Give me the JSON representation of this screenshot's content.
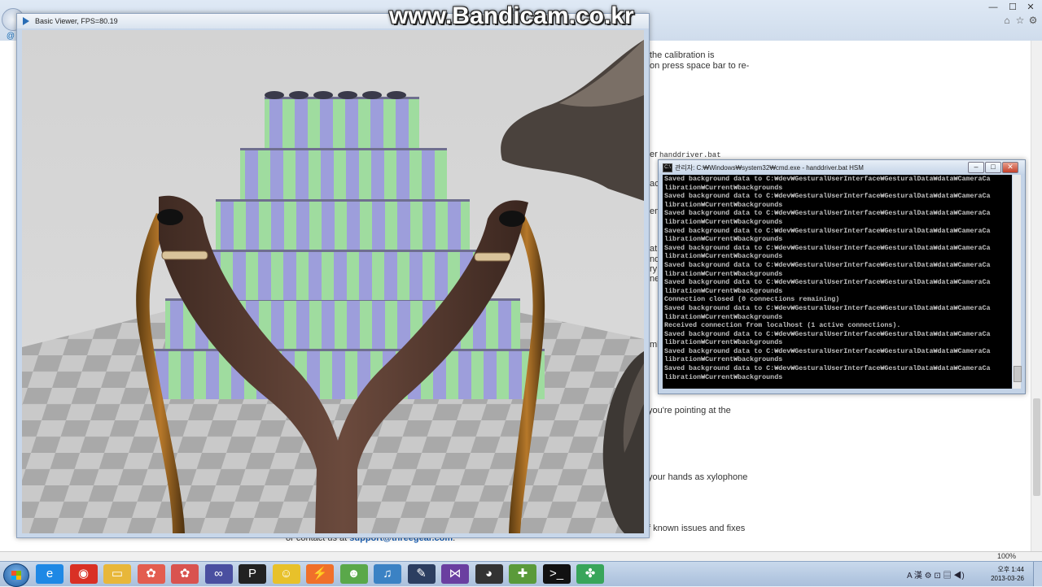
{
  "watermark": "www.Bandicam.co.kr",
  "viewer": {
    "title": "Basic Viewer, FPS=80.19"
  },
  "browser": {
    "zoom": "100%",
    "page_texts": [
      "the calibration is",
      "on press space bar to re-",
      "er",
      "handdriver.bat",
      "ac",
      "em",
      "at",
      "nd",
      "ry",
      "ne",
      "mb",
      "you're pointing at the",
      "your hands as xylophone",
      "f known issues and fixes"
    ],
    "support_prefix": "or contact us at",
    "support_link": "support@threegear.com",
    "support_suffix": "."
  },
  "cmd": {
    "icon_text": "C:\\",
    "title": "관리자: C:₩Windows₩system32₩cmd.exe - handdriver.bat  HSM",
    "lines": [
      "Saved background data to C:₩dev₩GesturalUserInterface₩GesturalData₩data₩CameraCa",
      "libration₩Current₩backgrounds",
      "Saved background data to C:₩dev₩GesturalUserInterface₩GesturalData₩data₩CameraCa",
      "libration₩Current₩backgrounds",
      "Saved background data to C:₩dev₩GesturalUserInterface₩GesturalData₩data₩CameraCa",
      "libration₩Current₩backgrounds",
      "Saved background data to C:₩dev₩GesturalUserInterface₩GesturalData₩data₩CameraCa",
      "libration₩Current₩backgrounds",
      "Saved background data to C:₩dev₩GesturalUserInterface₩GesturalData₩data₩CameraCa",
      "libration₩Current₩backgrounds",
      "Saved background data to C:₩dev₩GesturalUserInterface₩GesturalData₩data₩CameraCa",
      "libration₩Current₩backgrounds",
      "Saved background data to C:₩dev₩GesturalUserInterface₩GesturalData₩data₩CameraCa",
      "libration₩Current₩backgrounds",
      "Connection closed (0 connections remaining)",
      "Saved background data to C:₩dev₩GesturalUserInterface₩GesturalData₩data₩CameraCa",
      "libration₩Current₩backgrounds",
      "Received connection from localhost (1 active connections).",
      "Saved background data to C:₩dev₩GesturalUserInterface₩GesturalData₩data₩CameraCa",
      "libration₩Current₩backgrounds",
      "Saved background data to C:₩dev₩GesturalUserInterface₩GesturalData₩data₩CameraCa",
      "libration₩Current₩backgrounds",
      "Saved background data to C:₩dev₩GesturalUserInterface₩GesturalData₩data₩CameraCa",
      "libration₩Current₩backgrounds"
    ]
  },
  "taskbar": {
    "icons": [
      {
        "name": "ie-icon",
        "glyph": "e",
        "color": "#1e88e5"
      },
      {
        "name": "chrome-icon",
        "glyph": "◉",
        "color": "#d93025"
      },
      {
        "name": "folder-icon",
        "glyph": "▭",
        "color": "#e8b73a"
      },
      {
        "name": "app-icon-1",
        "glyph": "✿",
        "color": "#e35d4f"
      },
      {
        "name": "app-icon-2",
        "glyph": "✿",
        "color": "#d9534f"
      },
      {
        "name": "app-icon-3",
        "glyph": "∞",
        "color": "#4a4fa0"
      },
      {
        "name": "p-app-icon",
        "glyph": "P",
        "color": "#222222"
      },
      {
        "name": "smiley-app-icon",
        "glyph": "☺",
        "color": "#e8c12a"
      },
      {
        "name": "bolt-app-icon",
        "glyph": "⚡",
        "color": "#f0702a"
      },
      {
        "name": "frog-app-icon",
        "glyph": "☻",
        "color": "#5aa84a"
      },
      {
        "name": "music-app-icon",
        "glyph": "♫",
        "color": "#3b82c4"
      },
      {
        "name": "editor-app-icon",
        "glyph": "✎",
        "color": "#2c3e60"
      },
      {
        "name": "vs-app-icon",
        "glyph": "⋈",
        "color": "#6a3fa0"
      },
      {
        "name": "panda-app-icon",
        "glyph": "◕",
        "color": "#333333"
      },
      {
        "name": "puzzle-app-icon",
        "glyph": "✚",
        "color": "#5a9a3a"
      },
      {
        "name": "cmd-app-icon",
        "glyph": ">_",
        "color": "#111111"
      },
      {
        "name": "threegear-app-icon",
        "glyph": "✤",
        "color": "#38a55a"
      }
    ],
    "tray_text": "A 漢 ⚙ ⊡ ▤ ◀)",
    "time": "오후 1:44",
    "date": "2013-03-26"
  }
}
